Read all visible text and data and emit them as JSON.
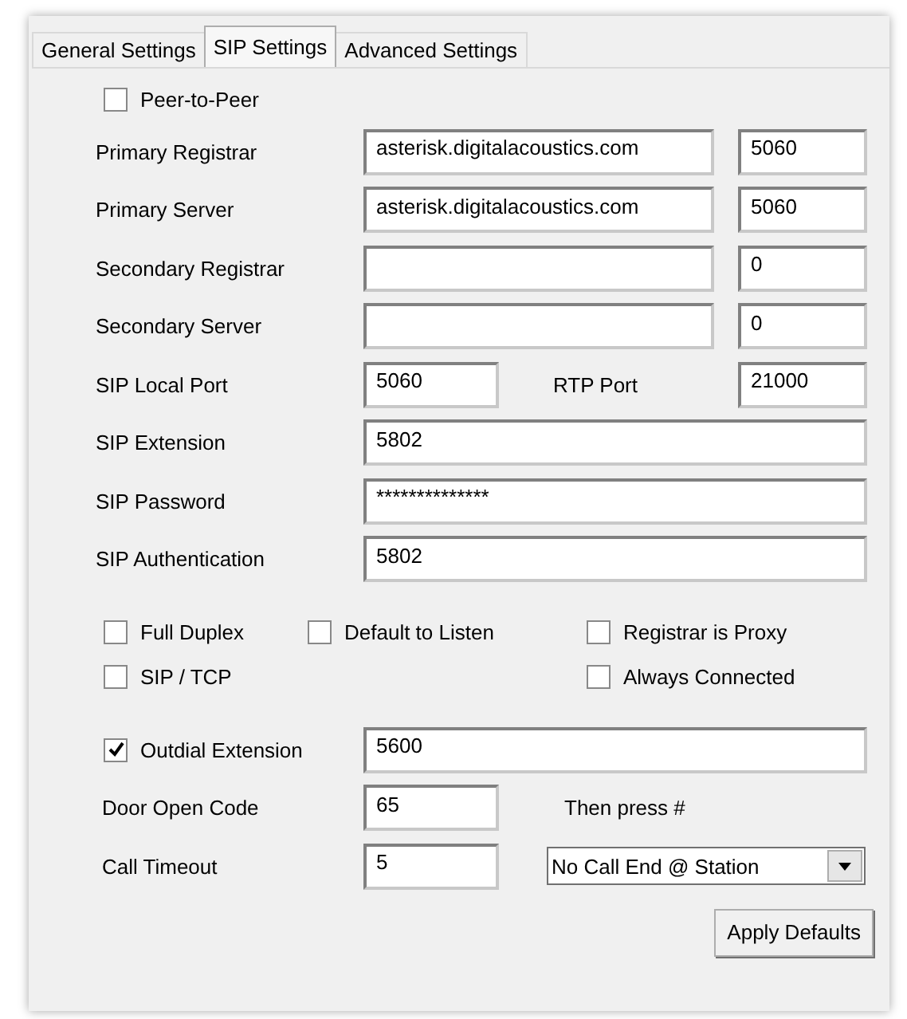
{
  "tabs": [
    {
      "label": "General Settings",
      "selected": false
    },
    {
      "label": "SIP Settings",
      "selected": true
    },
    {
      "label": "Advanced Settings",
      "selected": false
    }
  ],
  "peer_to_peer": {
    "label": "Peer-to-Peer",
    "checked": false
  },
  "server_rows": [
    {
      "label": "Primary Registrar",
      "host": "asterisk.digitalacoustics.com",
      "port": "5060"
    },
    {
      "label": "Primary Server",
      "host": "asterisk.digitalacoustics.com",
      "port": "5060"
    },
    {
      "label": "Secondary Registrar",
      "port": "0"
    },
    {
      "label": "Secondary Server",
      "port": "0"
    }
  ],
  "sip_local_port": {
    "label": "SIP Local Port",
    "value": "5060"
  },
  "rtp_port": {
    "label": "RTP Port",
    "value": "21000"
  },
  "credentials": [
    {
      "label": "SIP Extension",
      "value": "5802"
    },
    {
      "label": "SIP Password",
      "value": "**************"
    },
    {
      "label": "SIP Authentication",
      "value": "5802"
    }
  ],
  "option_rows": [
    [
      {
        "label": "Full Duplex",
        "checked": false
      },
      {
        "label": "Default to Listen",
        "checked": false
      },
      {
        "label": "Registrar is Proxy",
        "checked": false
      }
    ],
    [
      {
        "label": "SIP / TCP",
        "checked": false
      },
      {
        "label": "Always Connected",
        "checked": false
      }
    ]
  ],
  "outdial": {
    "label": "Outdial Extension",
    "checked": true,
    "value": "5600"
  },
  "door_open_code": {
    "label": "Door Open Code",
    "value": "65",
    "hint": "Then press #"
  },
  "call_timeout": {
    "label": "Call Timeout",
    "value": "5"
  },
  "call_end_mode": {
    "value": "No Call End @ Station"
  },
  "apply_button": {
    "label": "Apply Defaults"
  }
}
